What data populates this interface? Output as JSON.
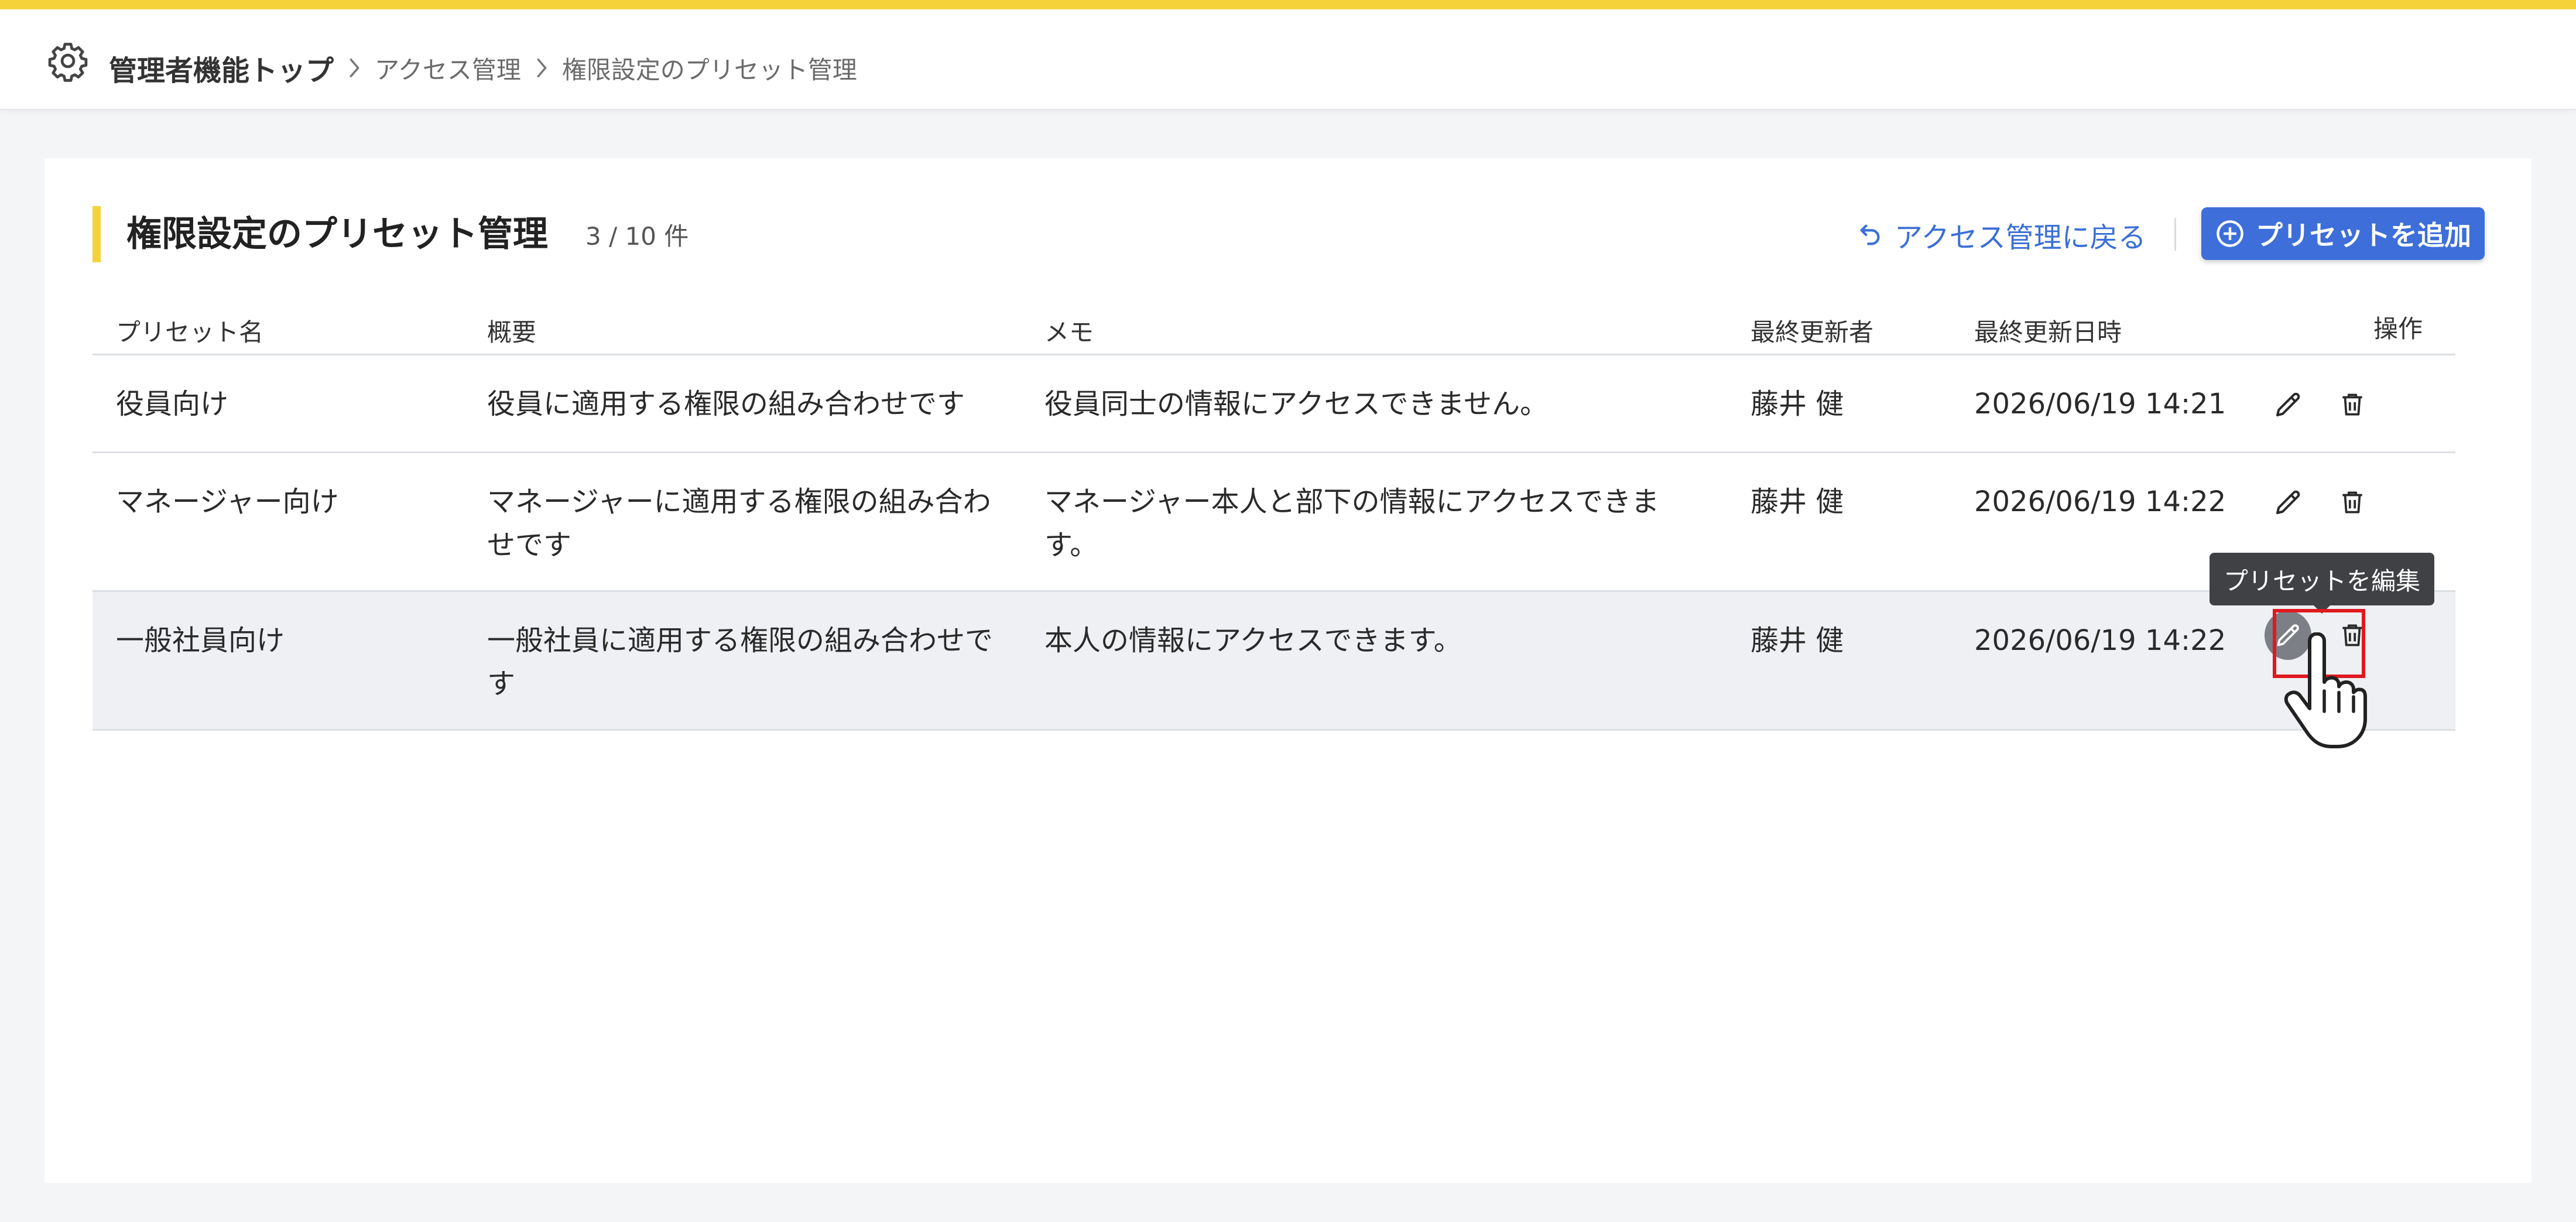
{
  "breadcrumb": {
    "top": "管理者機能トップ",
    "items": [
      "アクセス管理",
      "権限設定のプリセット管理"
    ]
  },
  "page": {
    "title": "権限設定のプリセット管理",
    "count": "3 / 10 件",
    "back_label": "アクセス管理に戻る",
    "add_label": "プリセットを追加"
  },
  "table": {
    "headers": {
      "name": "プリセット名",
      "summary": "概要",
      "memo": "メモ",
      "updated_by": "最終更新者",
      "updated_at": "最終更新日時",
      "actions": "操作"
    },
    "rows": [
      {
        "name": "役員向け",
        "summary": "役員に適用する権限の組み合わせです",
        "memo": "役員同士の情報にアクセスできません。",
        "updated_by": "藤井 健",
        "updated_at": "2026/06/19 14:21"
      },
      {
        "name": "マネージャー向け",
        "summary": "マネージャーに適用する権限の組み合わせです",
        "memo": "マネージャー本人と部下の情報にアクセスできます。",
        "updated_by": "藤井 健",
        "updated_at": "2026/06/19 14:22"
      },
      {
        "name": "一般社員向け",
        "summary": "一般社員に適用する権限の組み合わせです",
        "memo": "本人の情報にアクセスできます。",
        "updated_by": "藤井 健",
        "updated_at": "2026/06/19 14:22"
      }
    ]
  },
  "tooltip": {
    "edit": "プリセットを編集"
  },
  "colors": {
    "accent_yellow": "#f5d23a",
    "primary_blue": "#3d6ed9",
    "link_blue": "#3a6fd6",
    "highlight_red": "#e0191f"
  },
  "icons": {
    "settings": "gear-icon",
    "breadcrumb_separator": "chevron-right-icon",
    "back": "undo-arrow-icon",
    "add": "plus-circle-icon",
    "edit": "pencil-icon",
    "delete": "trash-icon",
    "cursor": "hand-pointer-icon"
  }
}
